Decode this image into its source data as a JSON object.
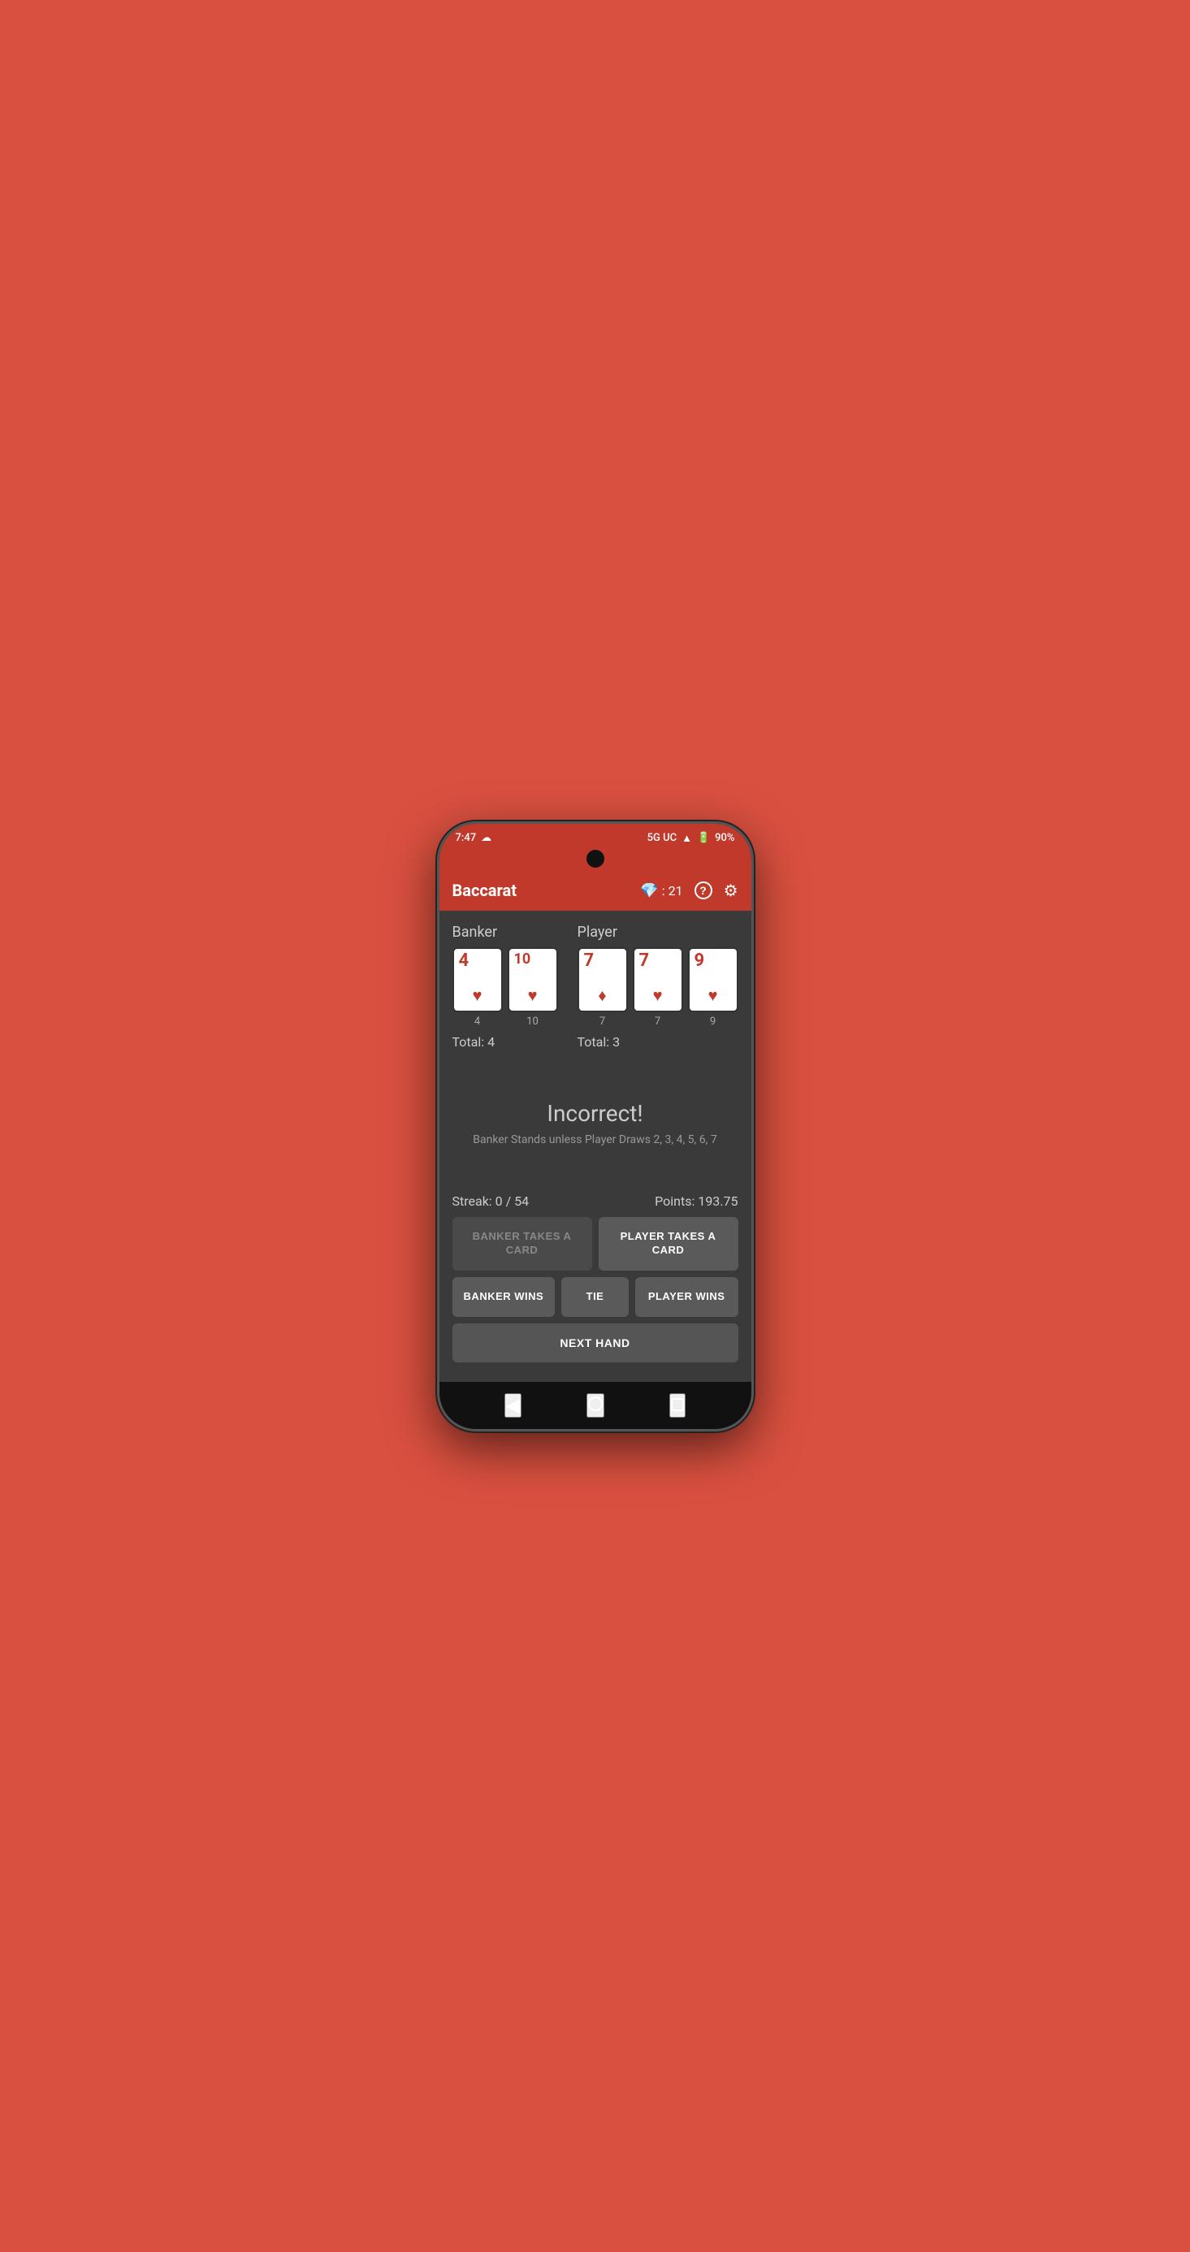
{
  "statusBar": {
    "time": "7:47",
    "network": "5G UC",
    "battery": "90%"
  },
  "appBar": {
    "title": "Baccarat",
    "gemScore": "21",
    "helpLabel": "?",
    "settingsLabel": "⚙"
  },
  "banker": {
    "label": "Banker",
    "cards": [
      {
        "value": "4",
        "suit": "♥",
        "num": "4"
      },
      {
        "value": "10",
        "suit": "♥",
        "num": "10"
      }
    ],
    "total": "Total: 4"
  },
  "player": {
    "label": "Player",
    "cards": [
      {
        "value": "7",
        "suit": "♦",
        "num": "7"
      },
      {
        "value": "7",
        "suit": "♥",
        "num": "7"
      },
      {
        "value": "9",
        "suit": "♥",
        "num": "9"
      }
    ],
    "total": "Total: 3"
  },
  "result": {
    "title": "Incorrect!",
    "subtitle": "Banker Stands unless Player Draws 2, 3, 4, 5, 6, 7"
  },
  "stats": {
    "streak": "Streak: 0 / 54",
    "points": "Points: 193.75"
  },
  "buttons": {
    "bankerTakesCard": "BANKER TAKES A CARD",
    "playerTakesCard": "PLAYER TAKES A CARD",
    "bankerWins": "BANKER WINS",
    "tie": "TIE",
    "playerWins": "PLAYER WINS",
    "nextHand": "NEXT HAND"
  },
  "navBar": {
    "back": "◀",
    "home": "●",
    "square": "■"
  }
}
